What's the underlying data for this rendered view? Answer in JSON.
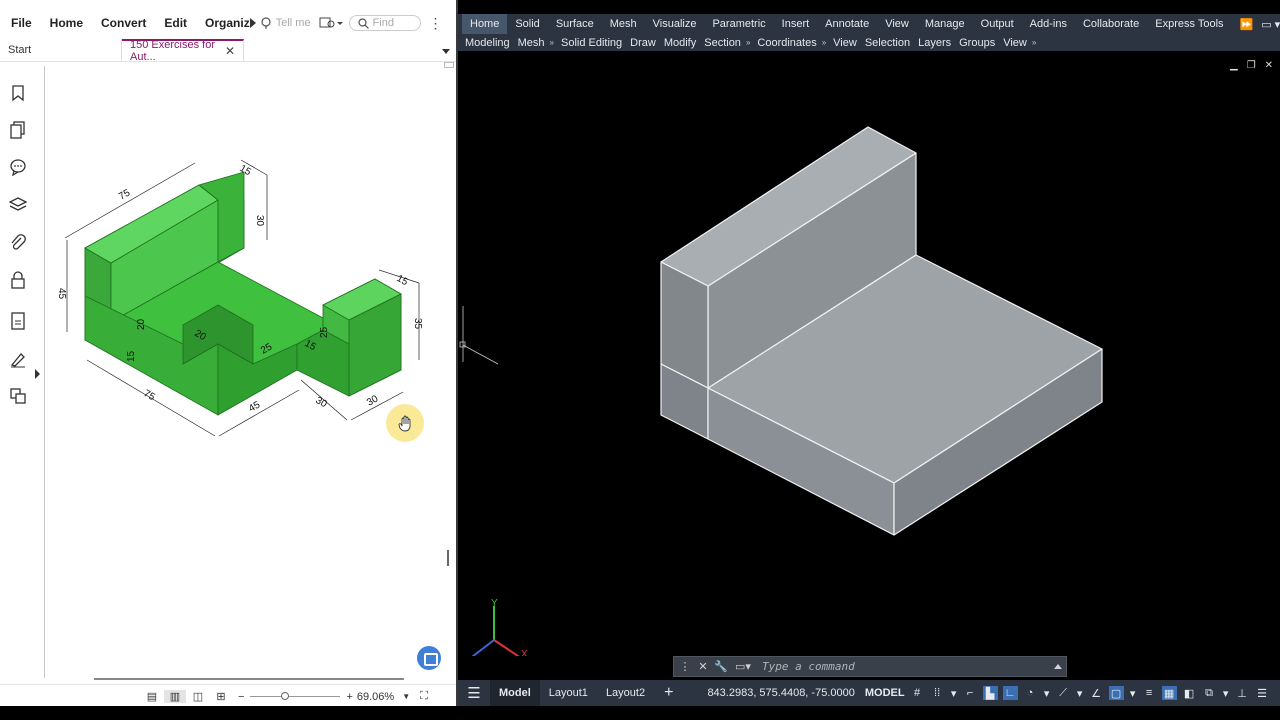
{
  "pdf": {
    "menu": [
      {
        "label": "File",
        "name": "menu-file"
      },
      {
        "label": "Home",
        "name": "menu-home"
      },
      {
        "label": "Convert",
        "name": "menu-convert"
      },
      {
        "label": "Edit",
        "name": "menu-edit"
      },
      {
        "label": "Organiz",
        "name": "menu-organize"
      }
    ],
    "tell_me_placeholder": "Tell me",
    "find_placeholder": "Find",
    "tabs": {
      "start": "Start",
      "doc": "150 Exercises for Aut..."
    },
    "zoom_text": "69.06%",
    "zoom_level": 0.38,
    "drawing_dims": {
      "d75_top": "75",
      "d15_top": "15",
      "d30_top": "30",
      "d45_left": "45",
      "d20_left": "20",
      "d15_left": "15",
      "d75_bottom": "75",
      "d45_bottom": "45",
      "d30_bottom_a": "30",
      "d30_bottom_b": "30",
      "d20_notch": "20",
      "d25_step": "25",
      "d15_step": "15",
      "d25_right": "25",
      "d15_right": "15",
      "d35_right": "35"
    }
  },
  "cad": {
    "ribbon_tabs": [
      "Home",
      "Solid",
      "Surface",
      "Mesh",
      "Visualize",
      "Parametric",
      "Insert",
      "Annotate",
      "View",
      "Manage",
      "Output",
      "Add-ins",
      "Collaborate",
      "Express Tools"
    ],
    "toolbar_items": [
      {
        "label": "Modeling",
        "more": false
      },
      {
        "label": "Mesh",
        "more": true
      },
      {
        "label": "Solid Editing",
        "more": false
      },
      {
        "label": "Draw",
        "more": false
      },
      {
        "label": "Modify",
        "more": false
      },
      {
        "label": "Section",
        "more": true
      },
      {
        "label": "Coordinates",
        "more": true
      },
      {
        "label": "View",
        "more": false
      },
      {
        "label": "Selection",
        "more": false
      },
      {
        "label": "Layers",
        "more": false
      },
      {
        "label": "Groups",
        "more": false
      },
      {
        "label": "View",
        "more": true
      }
    ],
    "command_placeholder": "Type a command",
    "layout_tabs": [
      "Model",
      "Layout1",
      "Layout2"
    ],
    "coords": "843.2983, 575.4408, -75.0000",
    "space": "MODEL",
    "ucs": {
      "x": "X",
      "y": "Y"
    },
    "colors": {
      "background": "#000000",
      "ribbon": "#2b3440",
      "solid_face": "#8f959b",
      "solid_face_light": "#a9aeb3",
      "solid_face_dark": "#7e848a",
      "green_model": "#3fbf3f"
    }
  }
}
